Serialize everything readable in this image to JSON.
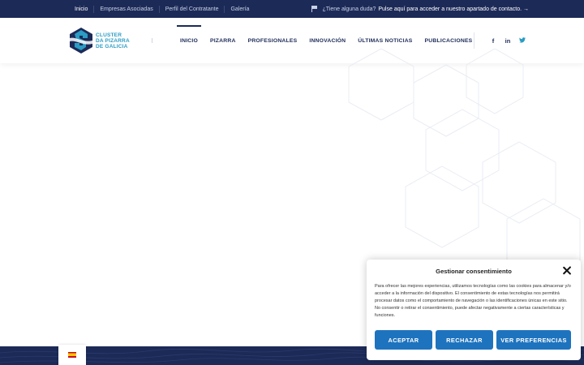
{
  "topbar": {
    "links": [
      "Inicio",
      "Empresas Asociadas",
      "Perfil del Contratante",
      "Galería"
    ],
    "info_prefix": "¿Tiene alguna duda?",
    "info_text": "Pulse aquí para acceder a nuestro apartado de contacto. →"
  },
  "logo": {
    "line1": "CLUSTER",
    "line2": "DA PIZARRA",
    "line3": "DE GALICIA"
  },
  "nav": {
    "items": [
      "INICIO",
      "PIZARRA",
      "PROFESIONALES",
      "INNOVACIÓN",
      "ÚLTIMAS NOTICIAS",
      "PUBLICACIONES"
    ]
  },
  "social": {
    "facebook": "f",
    "linkedin": "in",
    "twitter": "🐦"
  },
  "consent": {
    "title": "Gestionar consentimiento",
    "body": "Para ofrecer las mejores experiencias, utilizamos tecnologías como las cookies para almacenar y/o acceder a la información del dispositivo. El consentimiento de estas tecnologías nos permitirá procesar datos como el comportamiento de navegación o las identificaciones únicas en este sitio. No consentir o retirar el consentimiento, puede afectar negativamente a ciertas características y funciones.",
    "accept": "ACEPTAR",
    "reject": "RECHAZAR",
    "prefs": "VER PREFERENCIAS"
  },
  "colors": {
    "navy": "#1c2a57",
    "accent_blue": "#1e73be",
    "logo_cyan": "#2b9cc4"
  },
  "icons": [
    "flag-icon",
    "facebook-icon",
    "linkedin-icon",
    "twitter-icon",
    "close-icon",
    "spain-flag-icon"
  ]
}
